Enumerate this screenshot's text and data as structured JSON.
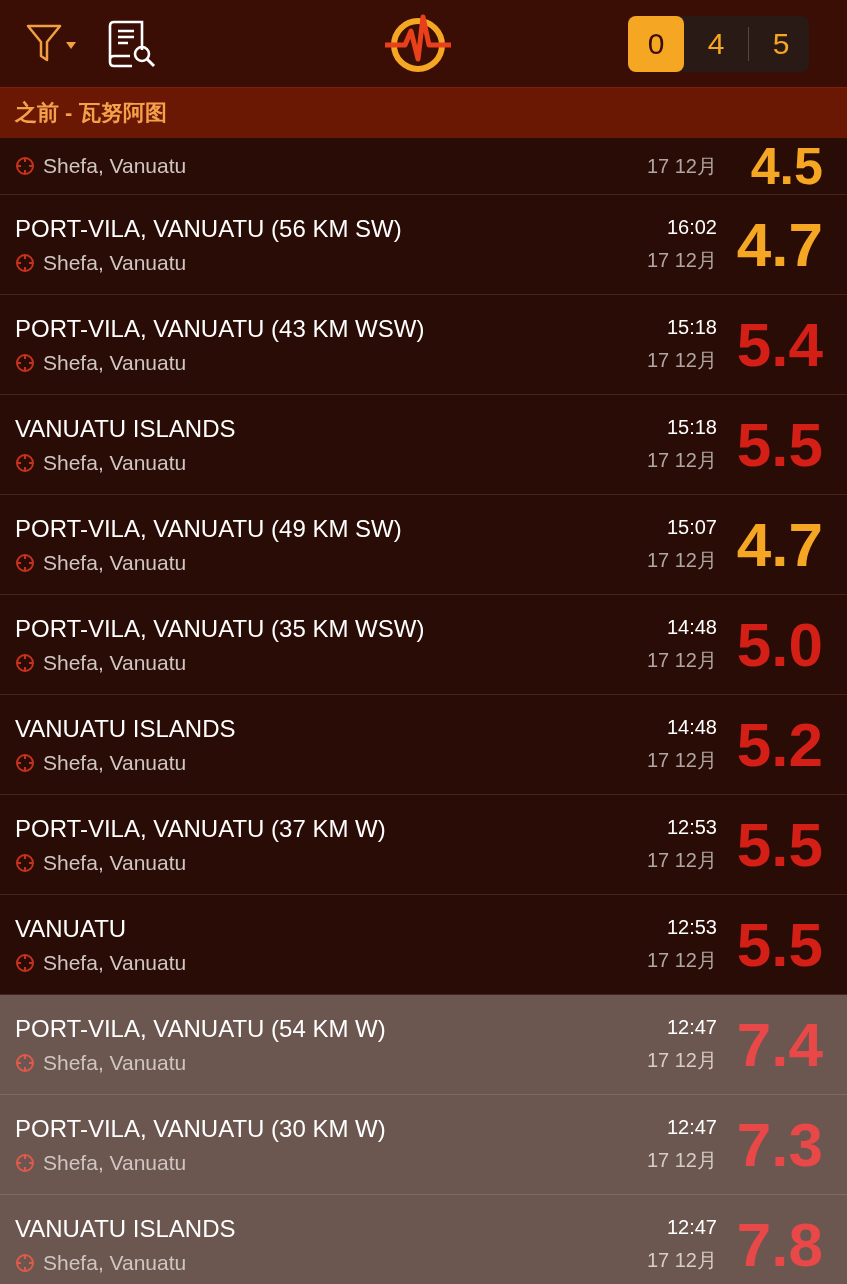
{
  "counters": [
    {
      "label": "0",
      "selected": true
    },
    {
      "label": "4",
      "selected": false
    },
    {
      "label": "5",
      "selected": false
    }
  ],
  "section": {
    "title": "之前 - 瓦努阿图"
  },
  "events": [
    {
      "region": "Shefa, Vanuatu",
      "date": "17 12月",
      "magnitude": "4.5",
      "color": "#f5a623",
      "highlighted": false
    },
    {
      "title": "PORT-VILA, VANUATU (56 KM SW)",
      "region": "Shefa, Vanuatu",
      "time": "16:02",
      "date": "17 12月",
      "magnitude": "4.7",
      "color": "#f5a623",
      "highlighted": false
    },
    {
      "title": "PORT-VILA, VANUATU (43 KM WSW)",
      "region": "Shefa, Vanuatu",
      "time": "15:18",
      "date": "17 12月",
      "magnitude": "5.4",
      "color": "#d41f17",
      "highlighted": false
    },
    {
      "title": "VANUATU ISLANDS",
      "region": "Shefa, Vanuatu",
      "time": "15:18",
      "date": "17 12月",
      "magnitude": "5.5",
      "color": "#d41f17",
      "highlighted": false
    },
    {
      "title": "PORT-VILA, VANUATU (49 KM SW)",
      "region": "Shefa, Vanuatu",
      "time": "15:07",
      "date": "17 12月",
      "magnitude": "4.7",
      "color": "#f5a623",
      "highlighted": false
    },
    {
      "title": "PORT-VILA, VANUATU (35 KM WSW)",
      "region": "Shefa, Vanuatu",
      "time": "14:48",
      "date": "17 12月",
      "magnitude": "5.0",
      "color": "#d41f17",
      "highlighted": false
    },
    {
      "title": "VANUATU ISLANDS",
      "region": "Shefa, Vanuatu",
      "time": "14:48",
      "date": "17 12月",
      "magnitude": "5.2",
      "color": "#d41f17",
      "highlighted": false
    },
    {
      "title": "PORT-VILA, VANUATU (37 KM W)",
      "region": "Shefa, Vanuatu",
      "time": "12:53",
      "date": "17 12月",
      "magnitude": "5.5",
      "color": "#d41f17",
      "highlighted": false
    },
    {
      "title": "VANUATU",
      "region": "Shefa, Vanuatu",
      "time": "12:53",
      "date": "17 12月",
      "magnitude": "5.5",
      "color": "#d41f17",
      "highlighted": false
    },
    {
      "title": "PORT-VILA, VANUATU (54 KM W)",
      "region": "Shefa, Vanuatu",
      "time": "12:47",
      "date": "17 12月",
      "magnitude": "7.4",
      "color": "#e84848",
      "highlighted": true
    },
    {
      "title": "PORT-VILA, VANUATU (30 KM W)",
      "region": "Shefa, Vanuatu",
      "time": "12:47",
      "date": "17 12月",
      "magnitude": "7.3",
      "color": "#e84848",
      "highlighted": true
    },
    {
      "title": "VANUATU ISLANDS",
      "region": "Shefa, Vanuatu",
      "time": "12:47",
      "date": "17 12月",
      "magnitude": "7.8",
      "color": "#e84848",
      "highlighted": true
    }
  ]
}
